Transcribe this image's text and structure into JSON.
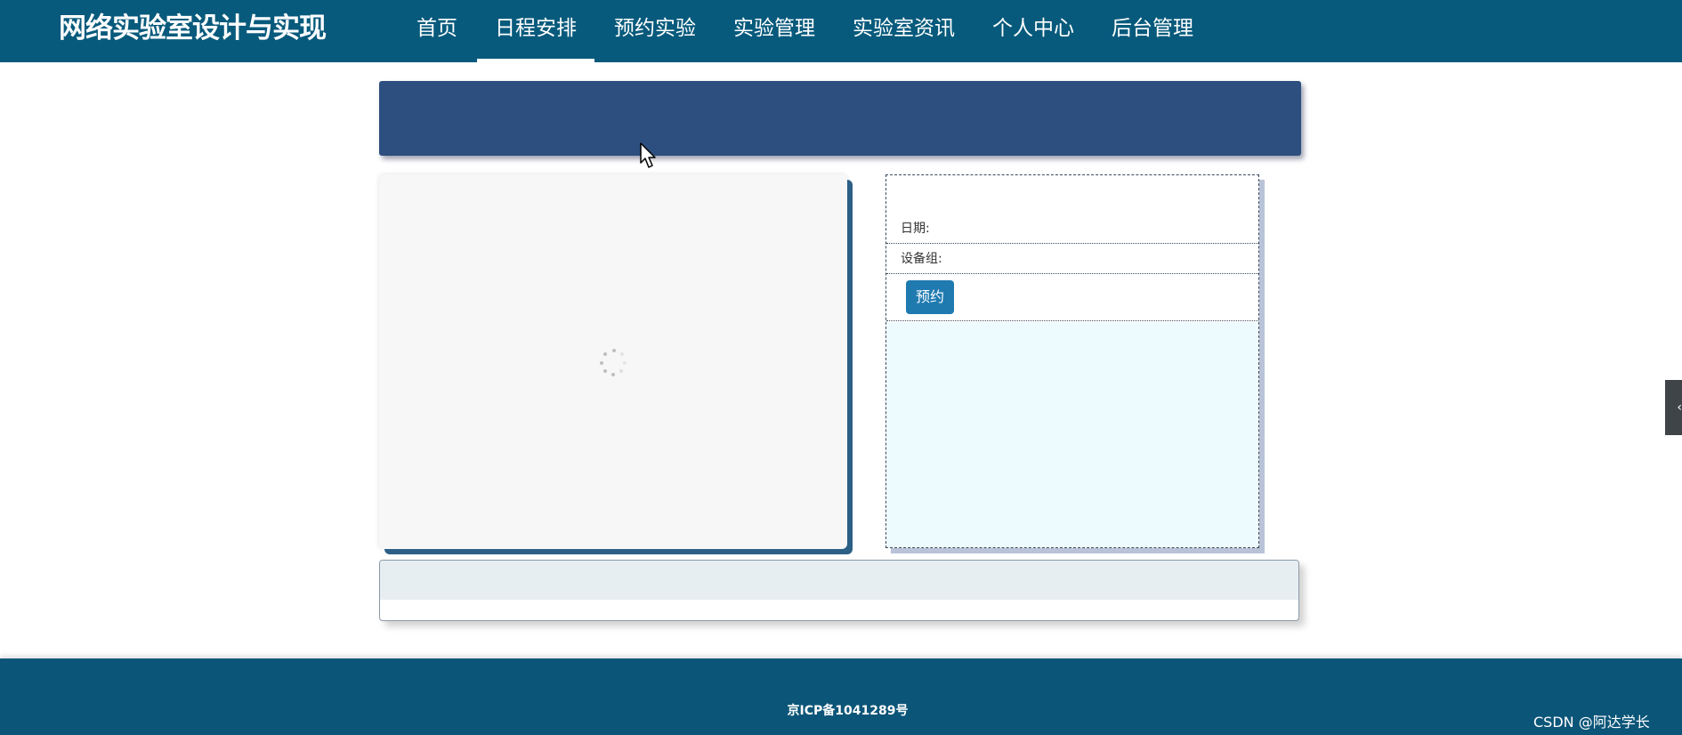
{
  "header": {
    "brand": "网络实验室设计与实现",
    "nav": [
      {
        "label": "首页",
        "active": false
      },
      {
        "label": "日程安排",
        "active": true
      },
      {
        "label": "预约实验",
        "active": false
      },
      {
        "label": "实验管理",
        "active": false
      },
      {
        "label": "实验室资讯",
        "active": false
      },
      {
        "label": "个人中心",
        "active": false
      },
      {
        "label": "后台管理",
        "active": false
      }
    ]
  },
  "booking": {
    "date_label": "日期:",
    "group_label": "设备组:",
    "reserve_label": "预约"
  },
  "footer": {
    "icp": "京ICP备1041289号"
  },
  "watermark": "CSDN @阿达学长",
  "side_handle_icon": "‹",
  "colors": {
    "header_bg": "#075a7c",
    "banner_bg": "#2d4f7f",
    "button_bg": "#1f7ab0",
    "result_bg": "#eefbfe",
    "footer_bg": "#0b5578"
  }
}
